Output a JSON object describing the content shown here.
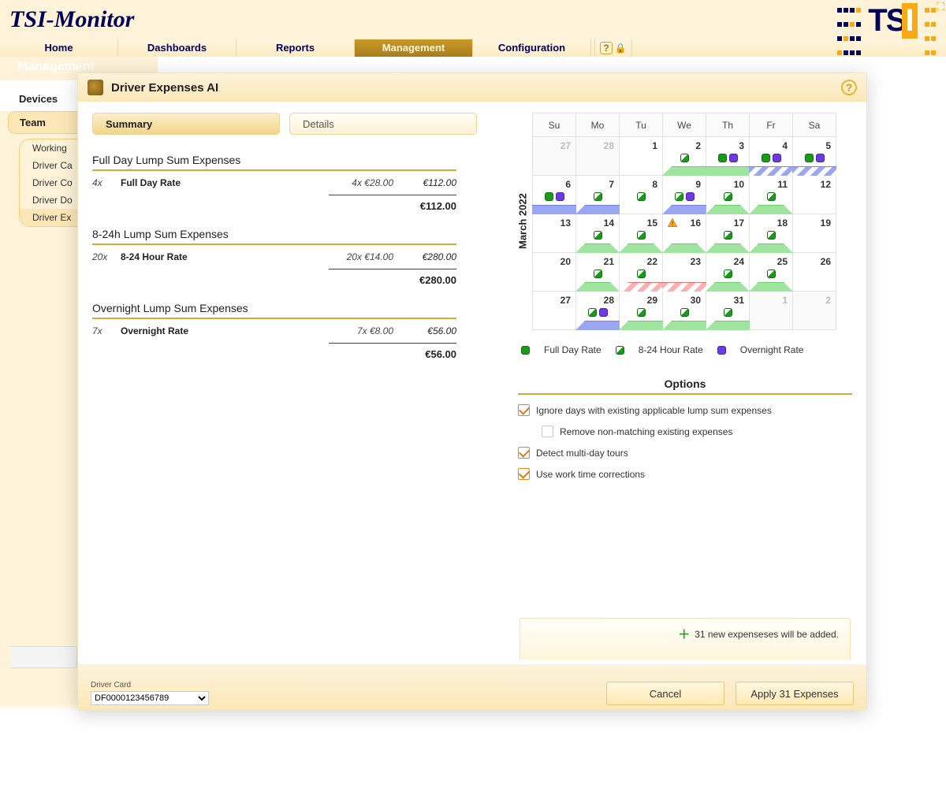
{
  "brand": "TSI-Monitor",
  "nav": {
    "items": [
      "Home",
      "Dashboards",
      "Reports",
      "Management",
      "Configuration"
    ],
    "active": 3
  },
  "section_title": "Management",
  "side_tabs": {
    "devices": "Devices",
    "team": "Team"
  },
  "side_list": [
    "Working",
    "Driver Ca",
    "Driver Co",
    "Driver Do",
    "Driver Ex"
  ],
  "side_selected": 4,
  "modal_title": "Driver Expenses AI",
  "tabs": {
    "summary": "Summary",
    "details": "Details"
  },
  "groups": [
    {
      "title": "Full Day Lump Sum Expenses",
      "qty": "4x",
      "name": "Full Day Rate",
      "calc": "4x €28.00",
      "amount": "€112.00",
      "total": "€112.00"
    },
    {
      "title": "8-24h Lump Sum Expenses",
      "qty": "20x",
      "name": "8-24 Hour Rate",
      "calc": "20x €14.00",
      "amount": "€280.00",
      "total": "€280.00"
    },
    {
      "title": "Overnight Lump Sum Expenses",
      "qty": "7x",
      "name": "Overnight Rate",
      "calc": "7x €8.00",
      "amount": "€56.00",
      "total": "€56.00"
    }
  ],
  "calendar": {
    "month": "March 2022",
    "dow": [
      "Su",
      "Mo",
      "Tu",
      "We",
      "Th",
      "Fr",
      "Sa"
    ],
    "cells": [
      {
        "n": 27,
        "other": true
      },
      {
        "n": 28,
        "other": true
      },
      {
        "n": 1,
        "marks": []
      },
      {
        "n": 2,
        "marks": [
          "part"
        ],
        "bar": "green start"
      },
      {
        "n": 3,
        "marks": [
          "full",
          "night"
        ],
        "bar": "green mid"
      },
      {
        "n": 4,
        "marks": [
          "full",
          "night"
        ],
        "bar": "bluehatch"
      },
      {
        "n": 5,
        "marks": [
          "full",
          "night"
        ],
        "bar": "bluehatch"
      },
      {
        "n": 6,
        "marks": [
          "full",
          "night"
        ],
        "bar": "blue"
      },
      {
        "n": 7,
        "marks": [
          "part"
        ],
        "bar": "blue start"
      },
      {
        "n": 8,
        "marks": [
          "part"
        ]
      },
      {
        "n": 9,
        "marks": [
          "part",
          "night"
        ],
        "bar": "blue start"
      },
      {
        "n": 10,
        "marks": [
          "part"
        ],
        "bar": "green"
      },
      {
        "n": 11,
        "marks": [
          "part"
        ],
        "bar": "green"
      },
      {
        "n": 12
      },
      {
        "n": 13
      },
      {
        "n": 14,
        "marks": [
          "part"
        ],
        "bar": "green"
      },
      {
        "n": 15,
        "marks": [
          "part"
        ],
        "bar": "green"
      },
      {
        "n": 16,
        "warn": true,
        "bar": "green"
      },
      {
        "n": 17,
        "marks": [
          "part"
        ],
        "bar": "green"
      },
      {
        "n": 18,
        "marks": [
          "part"
        ],
        "bar": "green"
      },
      {
        "n": 19
      },
      {
        "n": 20
      },
      {
        "n": 21,
        "marks": [
          "part"
        ],
        "bar": "green"
      },
      {
        "n": 22,
        "marks": [
          "part"
        ],
        "bar": "red"
      },
      {
        "n": 23,
        "bar": "red mid"
      },
      {
        "n": 24,
        "marks": [
          "part"
        ],
        "bar": "green"
      },
      {
        "n": 25,
        "marks": [
          "part"
        ],
        "bar": "green"
      },
      {
        "n": 26
      },
      {
        "n": 27
      },
      {
        "n": 28,
        "marks": [
          "part",
          "night"
        ],
        "bar": "blue start"
      },
      {
        "n": 29,
        "marks": [
          "part"
        ],
        "bar": "green start"
      },
      {
        "n": 30,
        "marks": [
          "part"
        ],
        "bar": "green start"
      },
      {
        "n": 31,
        "marks": [
          "part"
        ],
        "bar": "green start"
      },
      {
        "n": 1,
        "other": true
      },
      {
        "n": 2,
        "other": true
      }
    ]
  },
  "legend": {
    "full": "Full Day Rate",
    "part": "8-24 Hour Rate",
    "night": "Overnight Rate"
  },
  "options": {
    "title": "Options",
    "ignore": "Ignore days with existing applicable lump sum expenses",
    "remove": "Remove non-matching existing expenses",
    "detect": "Detect multi-day tours",
    "work": "Use work time corrections"
  },
  "note": "31 new expenseses will be added.",
  "footer": {
    "dc_label": "Driver Card",
    "dc_value": "DF0000123456789",
    "cancel": "Cancel",
    "apply": "Apply 31 Expenses"
  }
}
